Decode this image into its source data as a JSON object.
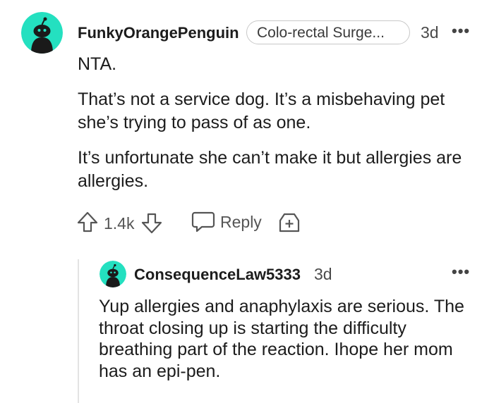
{
  "comment": {
    "username": "FunkyOrangePenguin",
    "flair": "Colo-rectal Surge...",
    "time": "3d",
    "more": "•••",
    "paragraphs": [
      "NTA.",
      "That’s not a service dog. It’s a misbehaving pet she’s trying to pass of as one.",
      "It’s unfortunate she can’t make it but allergies are allergies."
    ],
    "votes": "1.4k",
    "reply_label": "Reply"
  },
  "reply": {
    "username": "ConsequenceLaw5333",
    "time": "3d",
    "more": "•••",
    "body": "Yup allergies and anaphylaxis are serious. The throat closing up is starting the difficulty breathing part of the reaction. Ihope her mom has an epi-pen."
  },
  "colors": {
    "avatar_bg": "#24e0c0",
    "avatar_figure": "#1a1a1a"
  }
}
